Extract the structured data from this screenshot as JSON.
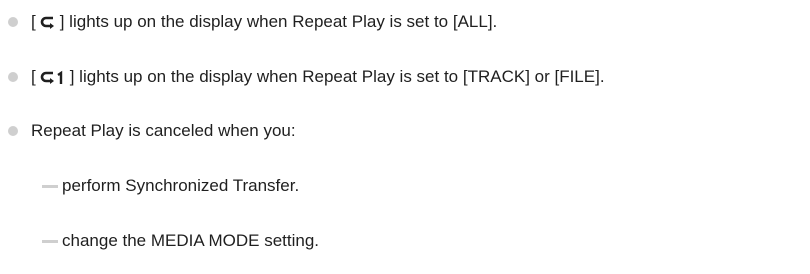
{
  "notes": {
    "item1": {
      "bracket_open": "[",
      "icon": "repeat-all-icon",
      "text": "] lights up on the display when Repeat Play is set to [ALL]."
    },
    "item2": {
      "bracket_open": "[",
      "icon": "repeat-one-icon",
      "text": "] lights up on the display when Repeat Play is set to [TRACK] or [FILE]."
    },
    "item3": {
      "text": "Repeat Play is canceled when you:"
    },
    "subitems": [
      "perform Synchronized Transfer.",
      "change the MEDIA MODE setting."
    ]
  }
}
